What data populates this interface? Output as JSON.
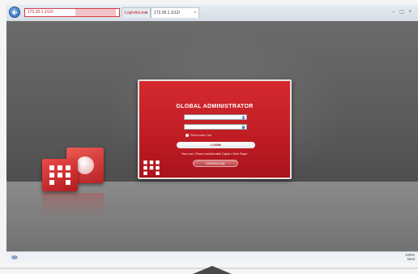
{
  "browser": {
    "address": "172.20.1.1/12/",
    "tabs": [
      {
        "label": "LoginAccess",
        "close": "×"
      },
      {
        "label": "172.20.1.1/12/",
        "close": "×"
      }
    ],
    "window_controls": "– ▢ ×"
  },
  "login": {
    "title": "GLOBAL ADMINISTRATOR",
    "remember_label": "Remember Me",
    "login_button": "LOGIN",
    "notice": "New user: Please install/enable Digital x Web Player",
    "download_button": "DOWNLOAD"
  },
  "status": {
    "zoom": "100%",
    "second_line": "Next"
  },
  "colors": {
    "brand_red": "#c01d24",
    "chrome": "#d6dde6"
  }
}
